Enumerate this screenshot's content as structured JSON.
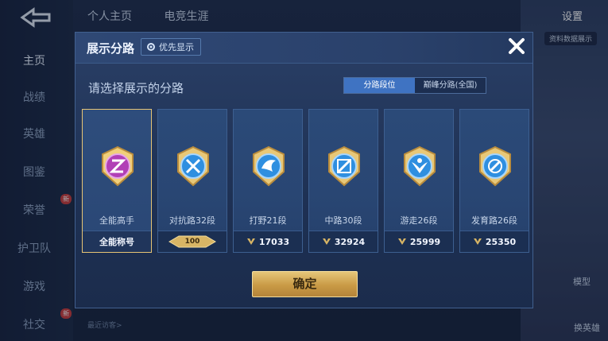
{
  "background": {
    "tabs": [
      "个人主页",
      "电竞生涯"
    ],
    "settings_label": "设置",
    "right_label": "资料数据展示",
    "model_label": "模型",
    "swap_label": "换英雄",
    "recent_visitors": "最近访客>",
    "sidebar": [
      {
        "label": "主页",
        "active": true
      },
      {
        "label": "战绩"
      },
      {
        "label": "英雄"
      },
      {
        "label": "图鉴"
      },
      {
        "label": "荣誉",
        "badge": "新"
      },
      {
        "label": "护卫队"
      },
      {
        "label": "游戏"
      },
      {
        "label": "社交",
        "badge": "新"
      }
    ]
  },
  "dialog": {
    "title": "展示分路",
    "priority_label": "优先显示",
    "subtitle": "请选择展示的分路",
    "toggle": {
      "left": "分路段位",
      "right": "巅峰分路(全国)",
      "selected": "left"
    },
    "confirm_label": "确定",
    "cards": [
      {
        "name": "全能高手",
        "footer": "全能称号",
        "emblem": "all-round-emblem",
        "selected": true
      },
      {
        "name": "对抗路32段",
        "footer": "100",
        "emblem": "clash-lane-emblem",
        "footer_type": "badge"
      },
      {
        "name": "打野21段",
        "footer": "17033",
        "emblem": "jungle-emblem"
      },
      {
        "name": "中路30段",
        "footer": "32924",
        "emblem": "mid-lane-emblem"
      },
      {
        "name": "游走26段",
        "footer": "25999",
        "emblem": "roam-emblem"
      },
      {
        "name": "发育路26段",
        "footer": "25350",
        "emblem": "farm-lane-emblem"
      }
    ]
  },
  "colors": {
    "accent": "#3f73c2",
    "gold": "#e6c474",
    "panel": "#1e3154"
  }
}
